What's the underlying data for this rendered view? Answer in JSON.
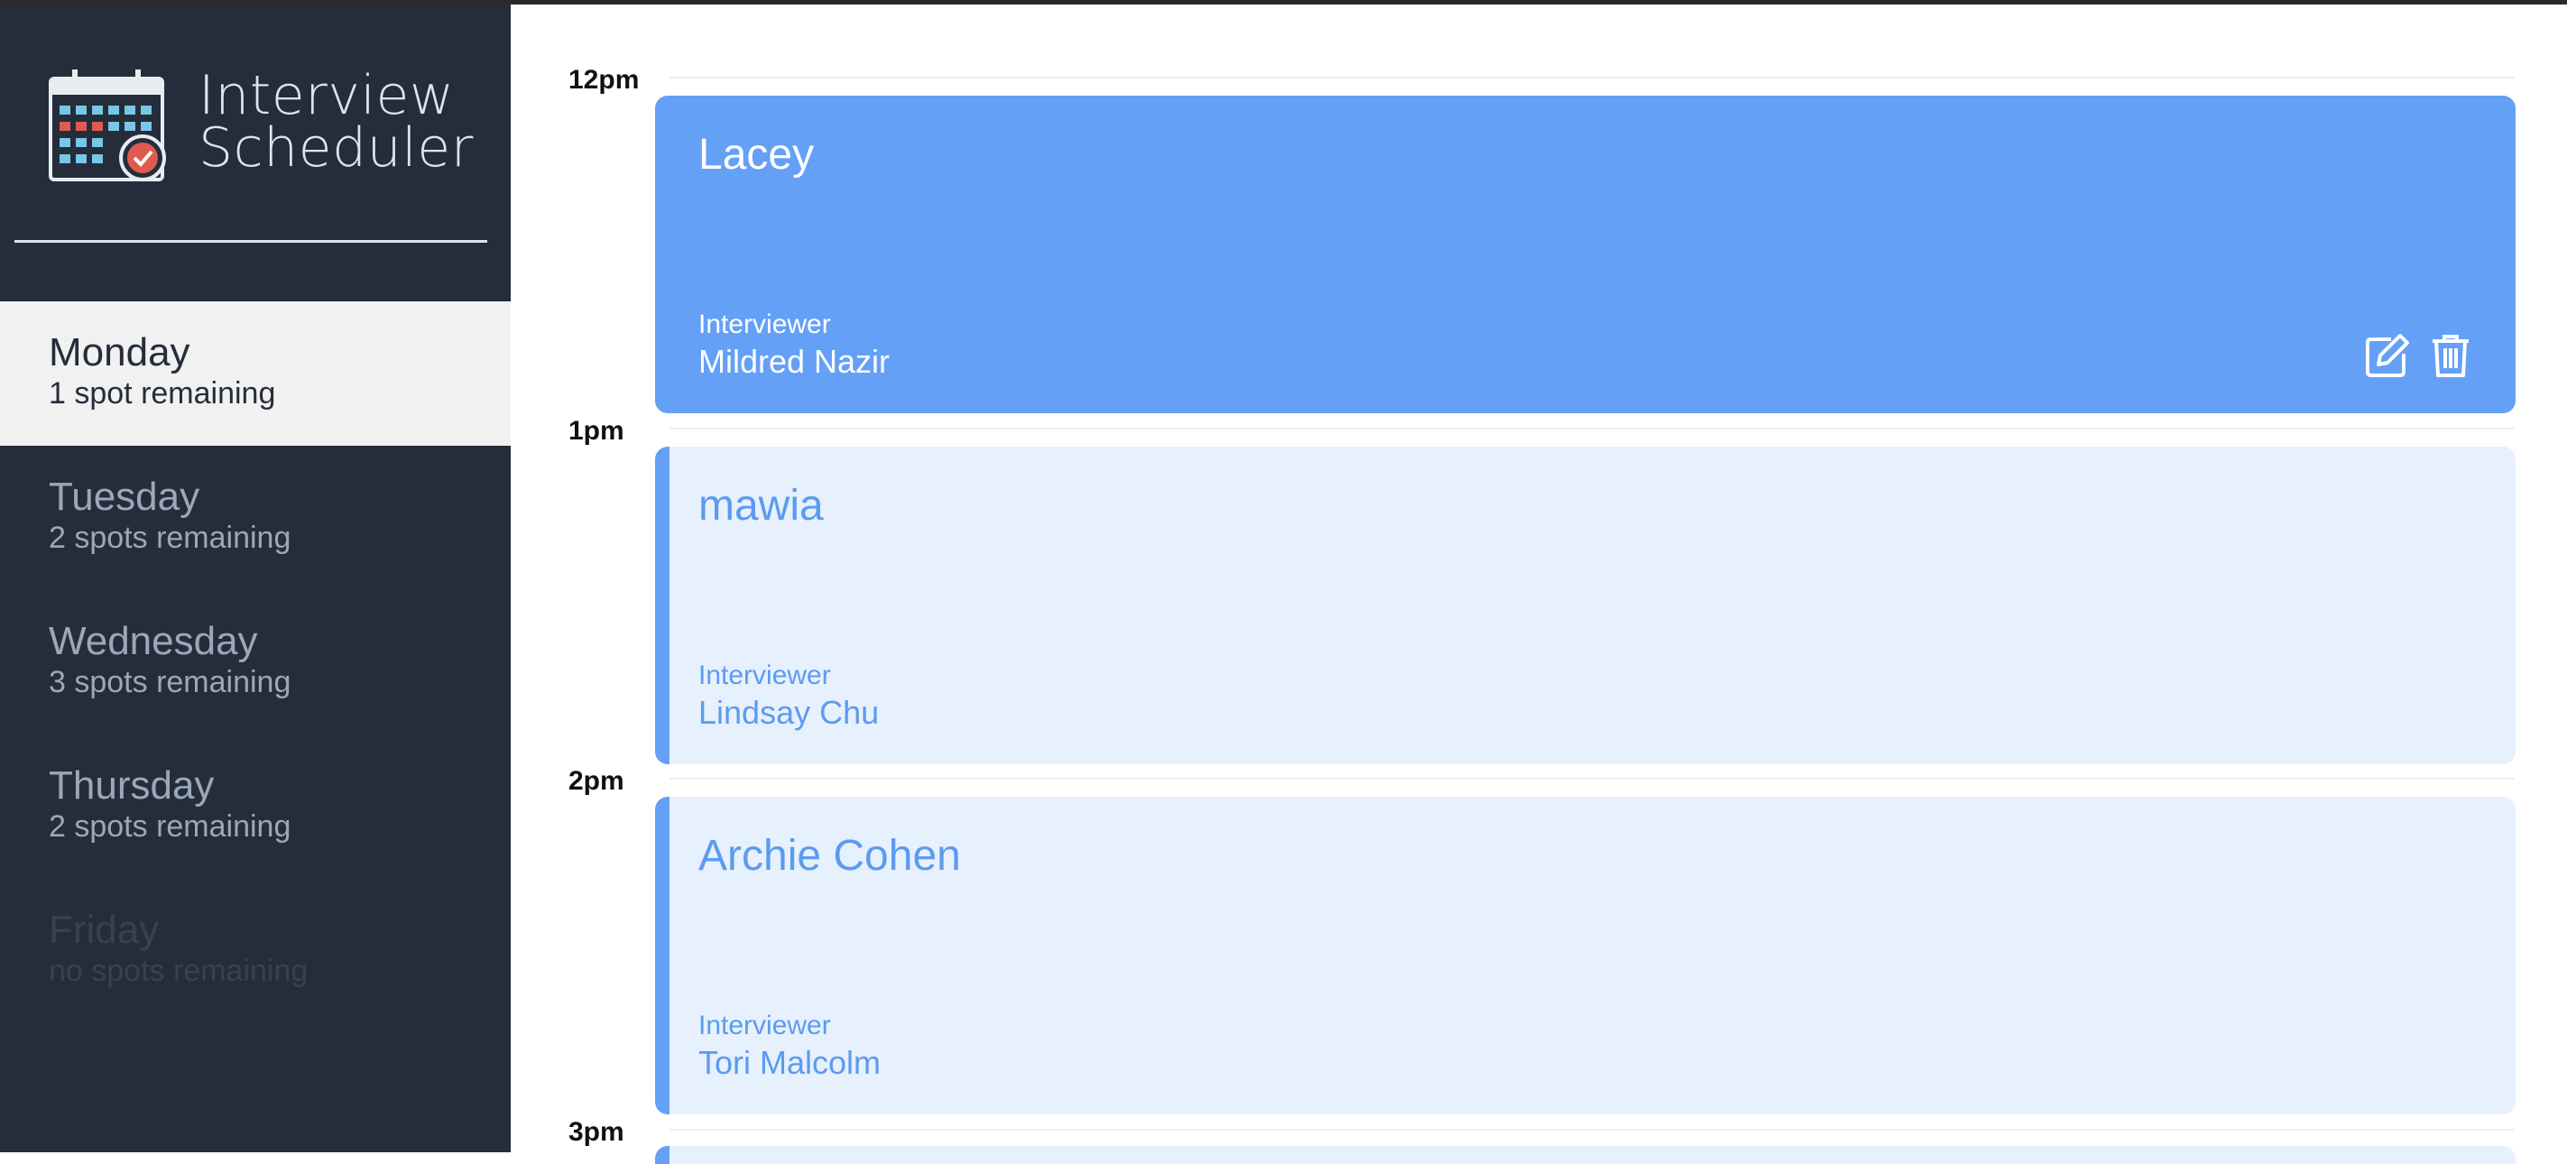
{
  "brand": {
    "line1": "Interview",
    "line2": "Scheduler",
    "icon": "calendar-check-icon"
  },
  "days": [
    {
      "name": "Monday",
      "spots": "1 spot remaining",
      "state": "selected"
    },
    {
      "name": "Tuesday",
      "spots": "2 spots remaining",
      "state": "normal"
    },
    {
      "name": "Wednesday",
      "spots": "3 spots remaining",
      "state": "normal"
    },
    {
      "name": "Thursday",
      "spots": "2 spots remaining",
      "state": "normal"
    },
    {
      "name": "Friday",
      "spots": "no spots remaining",
      "state": "full"
    }
  ],
  "hours": [
    "12pm",
    "1pm",
    "2pm",
    "3pm"
  ],
  "appointments": [
    {
      "student": "Lacey",
      "interviewer_label": "Interviewer",
      "interviewer": "Mildred Nazir",
      "state": "active"
    },
    {
      "student": "mawia",
      "interviewer_label": "Interviewer",
      "interviewer": "Lindsay Chu",
      "state": "booked"
    },
    {
      "student": "Archie Cohen",
      "interviewer_label": "Interviewer",
      "interviewer": "Tori Malcolm",
      "state": "booked"
    }
  ],
  "icons": {
    "edit": "edit-icon",
    "delete": "trash-icon"
  },
  "colors": {
    "sidebar": "#252d3b",
    "accent": "#64a0f6",
    "booked_bg": "#e7f0fd",
    "selected_day_bg": "#f1f1f1"
  }
}
